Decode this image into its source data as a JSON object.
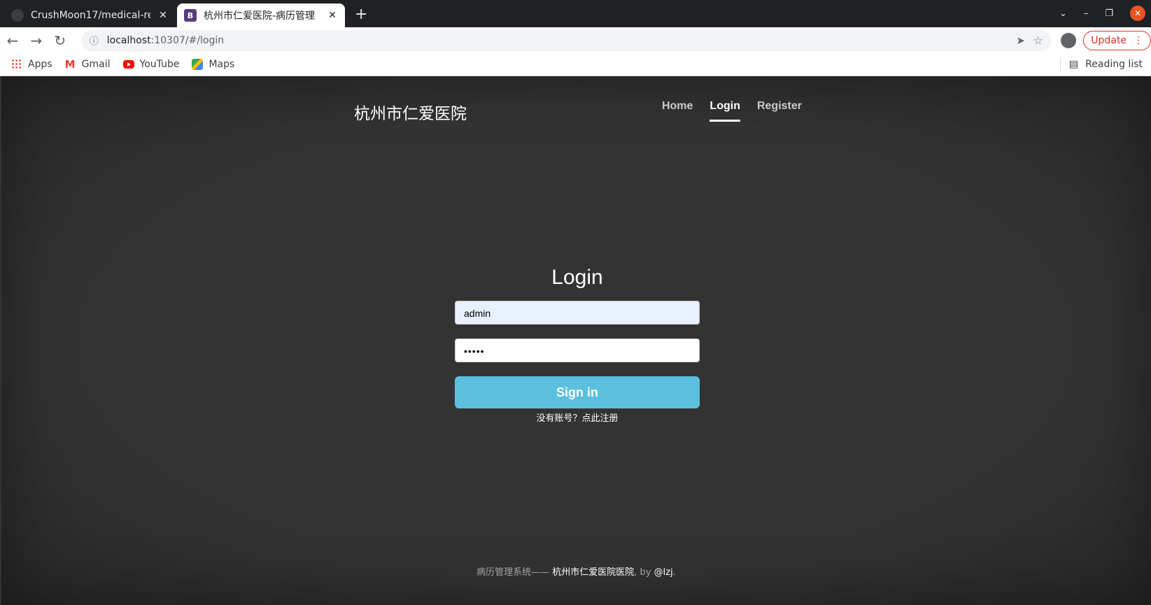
{
  "browser": {
    "tabs": [
      {
        "title": "CrushMoon17/medical-re",
        "favicon": "github-icon"
      },
      {
        "title": "杭州市仁爱医院-病历管理",
        "favicon": "bootstrap-icon",
        "favicon_letter": "B"
      }
    ],
    "new_tab": "+",
    "address": {
      "host": "localhost",
      "rest": ":10307/#/login"
    },
    "update_label": "Update",
    "bookmarks": [
      {
        "label": "Apps",
        "icon": "apps-icon"
      },
      {
        "label": "Gmail",
        "icon": "gmail-icon"
      },
      {
        "label": "YouTube",
        "icon": "youtube-icon"
      },
      {
        "label": "Maps",
        "icon": "maps-icon"
      }
    ],
    "reading_list": "Reading list"
  },
  "site": {
    "brand": "杭州市仁爱医院",
    "nav": [
      "Home",
      "Login",
      "Register"
    ],
    "active_nav": "Login"
  },
  "login": {
    "heading": "Login",
    "username": "admin",
    "password_mask": "•••••",
    "submit": "Sign in",
    "register_link": "没有账号？点此注册"
  },
  "footer": {
    "prefix": "病历管理系统—— ",
    "hospital": "杭州市仁爱医院医院",
    "by": ", by ",
    "author": "@lzj",
    "suffix": "."
  },
  "colors": {
    "accent": "#5bc0de",
    "background": "#333333",
    "update": "#d93025"
  }
}
